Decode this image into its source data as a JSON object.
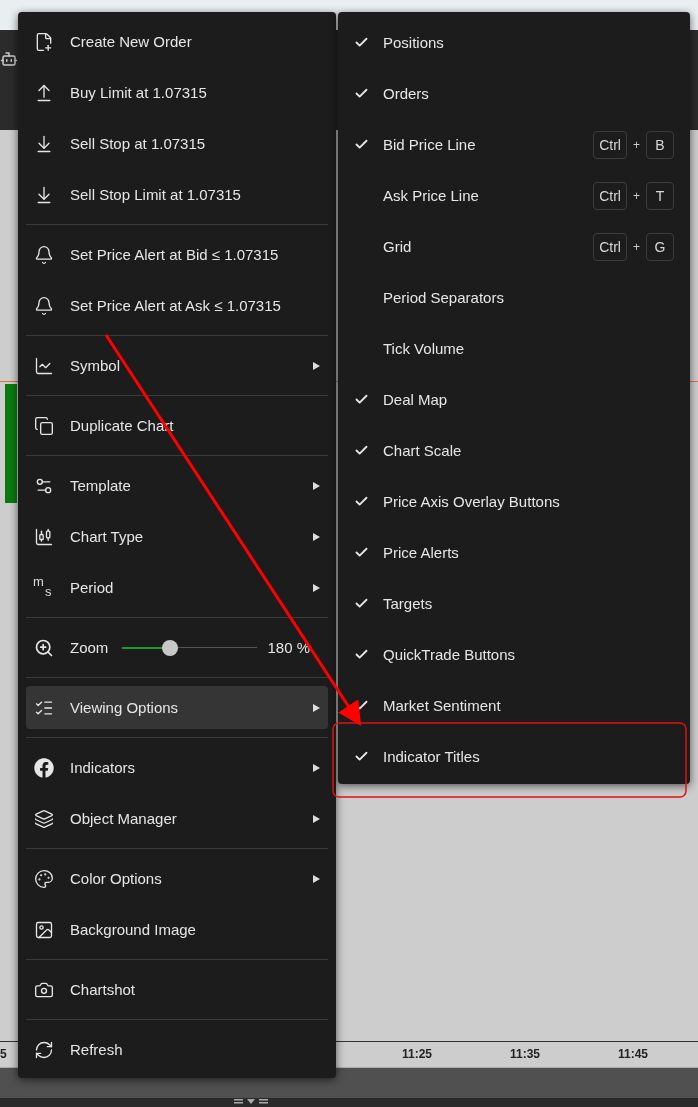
{
  "chart": {
    "time_axis": [
      {
        "label": "5"
      },
      {
        "label": "11:25"
      },
      {
        "label": "11:35"
      },
      {
        "label": "11:45"
      }
    ]
  },
  "context_menu": {
    "items": [
      {
        "kind": "action",
        "label": "Create New Order",
        "submenu": false,
        "selected": false
      },
      {
        "kind": "action",
        "label": "Buy Limit at 1.07315",
        "submenu": false,
        "selected": false
      },
      {
        "kind": "action",
        "label": "Sell Stop at 1.07315",
        "submenu": false,
        "selected": false
      },
      {
        "kind": "action",
        "label": "Sell Stop Limit at 1.07315",
        "submenu": false,
        "selected": false
      },
      {
        "kind": "separator"
      },
      {
        "kind": "action",
        "label": "Set Price Alert at Bid ≤ 1.07315",
        "submenu": false,
        "selected": false
      },
      {
        "kind": "action",
        "label": "Set Price Alert at Ask ≤ 1.07315",
        "submenu": false,
        "selected": false
      },
      {
        "kind": "separator"
      },
      {
        "kind": "action",
        "label": "Symbol",
        "submenu": true,
        "selected": false
      },
      {
        "kind": "separator"
      },
      {
        "kind": "action",
        "label": "Duplicate Chart",
        "submenu": false,
        "selected": false
      },
      {
        "kind": "separator"
      },
      {
        "kind": "action",
        "label": "Template",
        "submenu": true,
        "selected": false
      },
      {
        "kind": "action",
        "label": "Chart Type",
        "submenu": true,
        "selected": false
      },
      {
        "kind": "action",
        "label": "Period",
        "icon_text": [
          "m",
          "s"
        ],
        "submenu": true,
        "selected": false
      },
      {
        "kind": "separator"
      },
      {
        "kind": "slider",
        "label": "Zoom",
        "level": 0.35,
        "reading": "180 %"
      },
      {
        "kind": "separator"
      },
      {
        "kind": "action",
        "label": "Viewing Options",
        "submenu": true,
        "selected": true
      },
      {
        "kind": "separator"
      },
      {
        "kind": "action",
        "label": "Indicators",
        "submenu": true,
        "selected": false
      },
      {
        "kind": "action",
        "label": "Object Manager",
        "submenu": true,
        "selected": false
      },
      {
        "kind": "separator"
      },
      {
        "kind": "action",
        "label": "Color Options",
        "submenu": true,
        "selected": false
      },
      {
        "kind": "action",
        "label": "Background Image",
        "submenu": false,
        "selected": false
      },
      {
        "kind": "separator"
      },
      {
        "kind": "action",
        "label": "Chartshot",
        "submenu": false,
        "selected": false
      },
      {
        "kind": "separator"
      },
      {
        "kind": "action",
        "label": "Refresh",
        "submenu": false,
        "selected": false
      }
    ]
  },
  "viewing_options_menu": {
    "items": [
      {
        "label": "Positions",
        "checked": true,
        "annotated": false
      },
      {
        "label": "Orders",
        "checked": true,
        "annotated": false
      },
      {
        "label": "Bid Price Line",
        "checked": true,
        "annotated": false,
        "shortcut": {
          "keys": [
            "Ctrl",
            "B"
          ],
          "joiner": "+"
        }
      },
      {
        "label": "Ask Price Line",
        "checked": false,
        "annotated": false,
        "shortcut": {
          "keys": [
            "Ctrl",
            "T"
          ],
          "joiner": "+"
        }
      },
      {
        "label": "Grid",
        "checked": false,
        "annotated": false,
        "shortcut": {
          "keys": [
            "Ctrl",
            "G"
          ],
          "joiner": "+"
        }
      },
      {
        "label": "Period Separators",
        "checked": false,
        "annotated": false
      },
      {
        "label": "Tick Volume",
        "checked": false,
        "annotated": false
      },
      {
        "label": "Deal Map",
        "checked": true,
        "annotated": false
      },
      {
        "label": "Chart Scale",
        "checked": true,
        "annotated": false
      },
      {
        "label": "Price Axis Overlay Buttons",
        "checked": true,
        "annotated": false
      },
      {
        "label": "Price Alerts",
        "checked": true,
        "annotated": false
      },
      {
        "label": "Targets",
        "checked": true,
        "annotated": false
      },
      {
        "label": "QuickTrade Buttons",
        "checked": true,
        "annotated": false
      },
      {
        "label": "Market Sentiment",
        "checked": true,
        "annotated": false
      },
      {
        "label": "Indicator Titles",
        "checked": true,
        "annotated": true
      }
    ]
  }
}
